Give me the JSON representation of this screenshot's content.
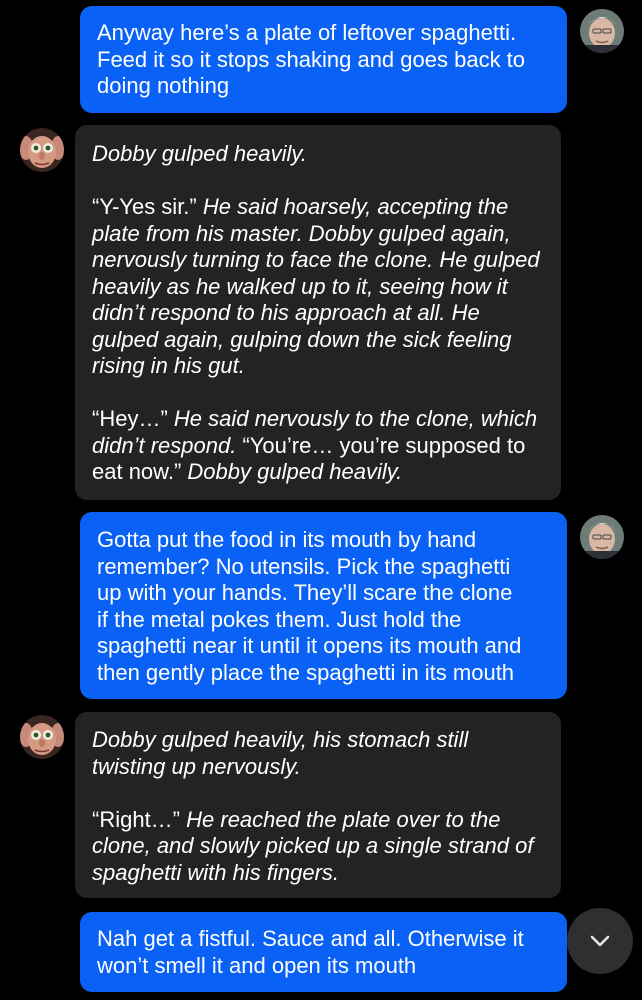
{
  "messages": [
    {
      "role": "user",
      "lines": [
        "Anyway here’s a plate of leftover spaghetti.",
        "Feed it so it stops shaking and goes back to",
        "doing nothing"
      ]
    },
    {
      "role": "assistant",
      "paragraphs": [
        {
          "narration": "Dobby gulped heavily."
        },
        {
          "quote": "“Y-Yes sir.”",
          "narration": " He said hoarsely, accepting the plate from his master. Dobby gulped again, nervously turning to face the clone. He gulped heavily as he walked up to it, seeing how it didn’t respond to his approach at all. He gulped again, gulping down the sick feeling rising in his gut."
        },
        {
          "quote": "“Hey…”",
          "narration": " He said nervously to the clone, which didn’t respond. ",
          "quote2": "“You’re… you’re supposed to eat now.”",
          "narration2": " Dobby gulped heavily."
        }
      ]
    },
    {
      "role": "user",
      "lines": [
        "Gotta put the food in its mouth by hand",
        "remember? No utensils. Pick the spaghetti",
        "up with your hands. They’ll scare the clone",
        "if the metal pokes them. Just hold the",
        "spaghetti near it until it opens its mouth and",
        "then gently place the spaghetti in its mouth"
      ]
    },
    {
      "role": "assistant",
      "paragraphs": [
        {
          "narration": "Dobby gulped heavily, his stomach still twisting up nervously."
        },
        {
          "quote": "“Right…”",
          "narration": " He reached the plate over to the clone, and slowly picked up a single strand of spaghetti with his fingers."
        }
      ]
    },
    {
      "role": "user",
      "lines": [
        "Nah get a fistful. Sauce and all. Otherwise it",
        "won’t smell it and open its mouth"
      ]
    }
  ],
  "icons": {
    "user_avatar": "user-avatar",
    "assistant_avatar": "dobby-avatar",
    "scroll": "chevron-down-icon"
  },
  "colors": {
    "background": "#000000",
    "user_bubble": "#0a61f5",
    "assistant_bubble": "#232323",
    "text": "#ffffff",
    "scroll_button": "#2f2f2f"
  }
}
